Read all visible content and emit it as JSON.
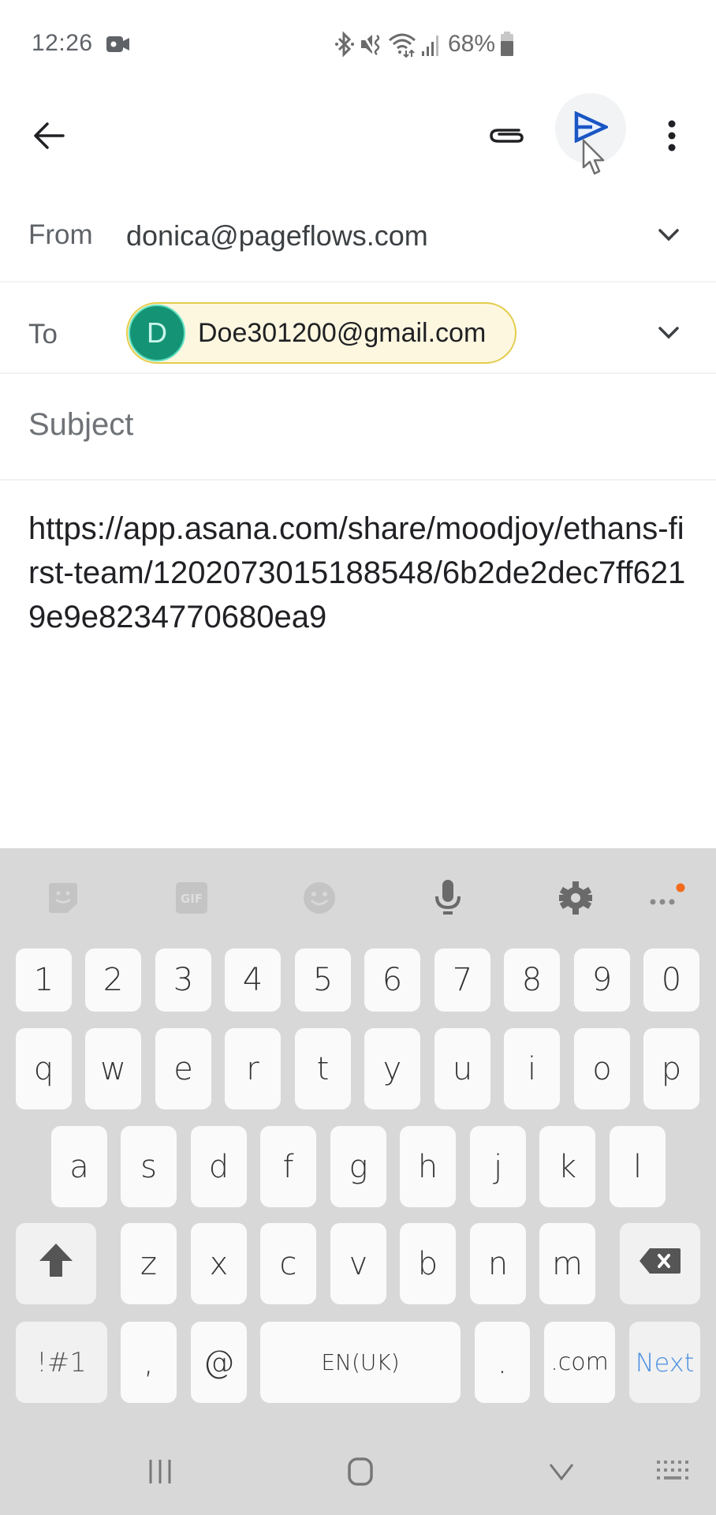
{
  "status_bar": {
    "time": "12:26",
    "battery_percent": "68%",
    "icons": [
      "screen-record-icon",
      "bluetooth-icon",
      "mute-vibrate-icon",
      "wifi-icon",
      "signal-icon",
      "battery-icon"
    ]
  },
  "toolbar": {
    "back_icon": "arrow-left",
    "attach_icon": "paperclip",
    "send_icon": "send",
    "more_icon": "more-vertical"
  },
  "compose": {
    "from_label": "From",
    "from_value": "donica@pageflows.com",
    "to_label": "To",
    "to_recipients": [
      {
        "initial": "D",
        "email": "Doe301200@gmail.com"
      }
    ],
    "subject_placeholder": "Subject",
    "subject_value": "",
    "body": "https://app.asana.com/share/moodjoy/ethans-first-team/1202073015188548/6b2de2dec7ff6219e9e8234770680ea9"
  },
  "keyboard": {
    "toolbar_icons": [
      "sticker-icon",
      "gif-icon",
      "emoji-icon",
      "microphone-icon",
      "settings-icon",
      "more-options-icon"
    ],
    "gif_label": "GIF",
    "rows": {
      "numbers": [
        "1",
        "2",
        "3",
        "4",
        "5",
        "6",
        "7",
        "8",
        "9",
        "0"
      ],
      "row1": [
        "q",
        "w",
        "e",
        "r",
        "t",
        "y",
        "u",
        "i",
        "o",
        "p"
      ],
      "row2": [
        "a",
        "s",
        "d",
        "f",
        "g",
        "h",
        "j",
        "k",
        "l"
      ],
      "row3": [
        "z",
        "x",
        "c",
        "v",
        "b",
        "n",
        "m"
      ]
    },
    "symbols_label": "!#1",
    "comma_label": ",",
    "at_label": "@",
    "space_label": "EN(UK)",
    "period_label": ".",
    "dotcom_label": ".com",
    "action_label": "Next"
  },
  "colors": {
    "accent_send": "#1a56c4",
    "chip_bg": "#fef7e0",
    "chip_border": "#e3cc4c",
    "avatar_bg": "#159475",
    "keyboard_bg": "#d8d8d8",
    "next_label": "#4a90e2",
    "notification_dot": "#f26b1d"
  }
}
